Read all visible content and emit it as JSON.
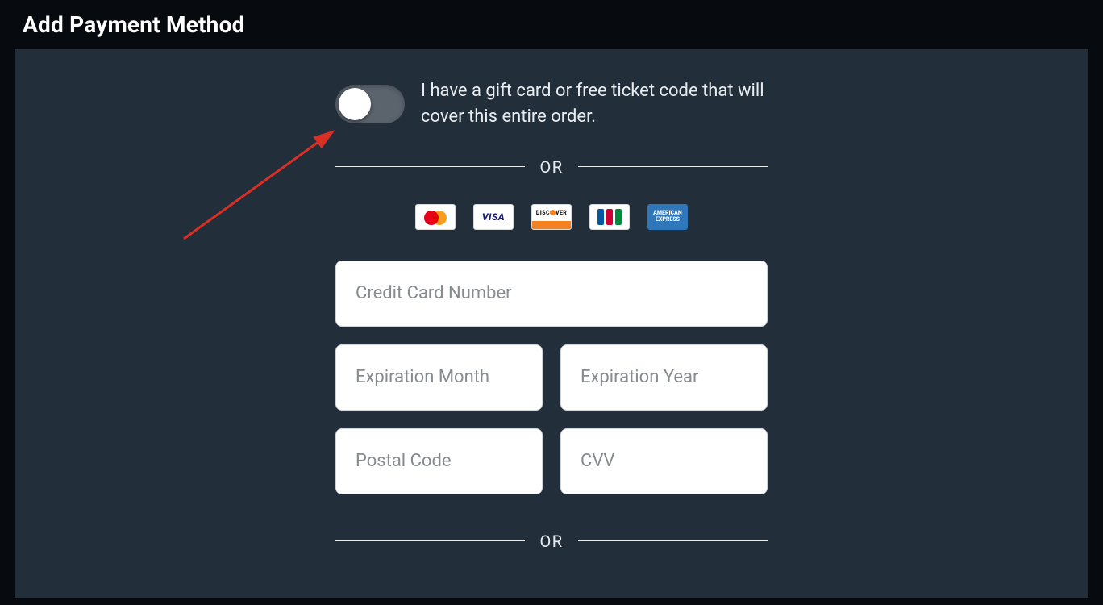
{
  "page": {
    "title": "Add Payment Method"
  },
  "giftcard": {
    "toggle_label": "I have a gift card or free ticket code that will cover this entire order.",
    "toggle_state": "off"
  },
  "dividers": {
    "or": "OR"
  },
  "card_brands": {
    "mastercard": "Mastercard",
    "visa": "VISA",
    "discover": "DISCOVER",
    "jcb": "JCB",
    "amex_line1": "AMERICAN",
    "amex_line2": "EXPRESS"
  },
  "form": {
    "card_number_placeholder": "Credit Card Number",
    "exp_month_placeholder": "Expiration Month",
    "exp_year_placeholder": "Expiration Year",
    "postal_placeholder": "Postal Code",
    "cvv_placeholder": "CVV"
  },
  "annotation": {
    "arrow_color": "#d93025"
  }
}
